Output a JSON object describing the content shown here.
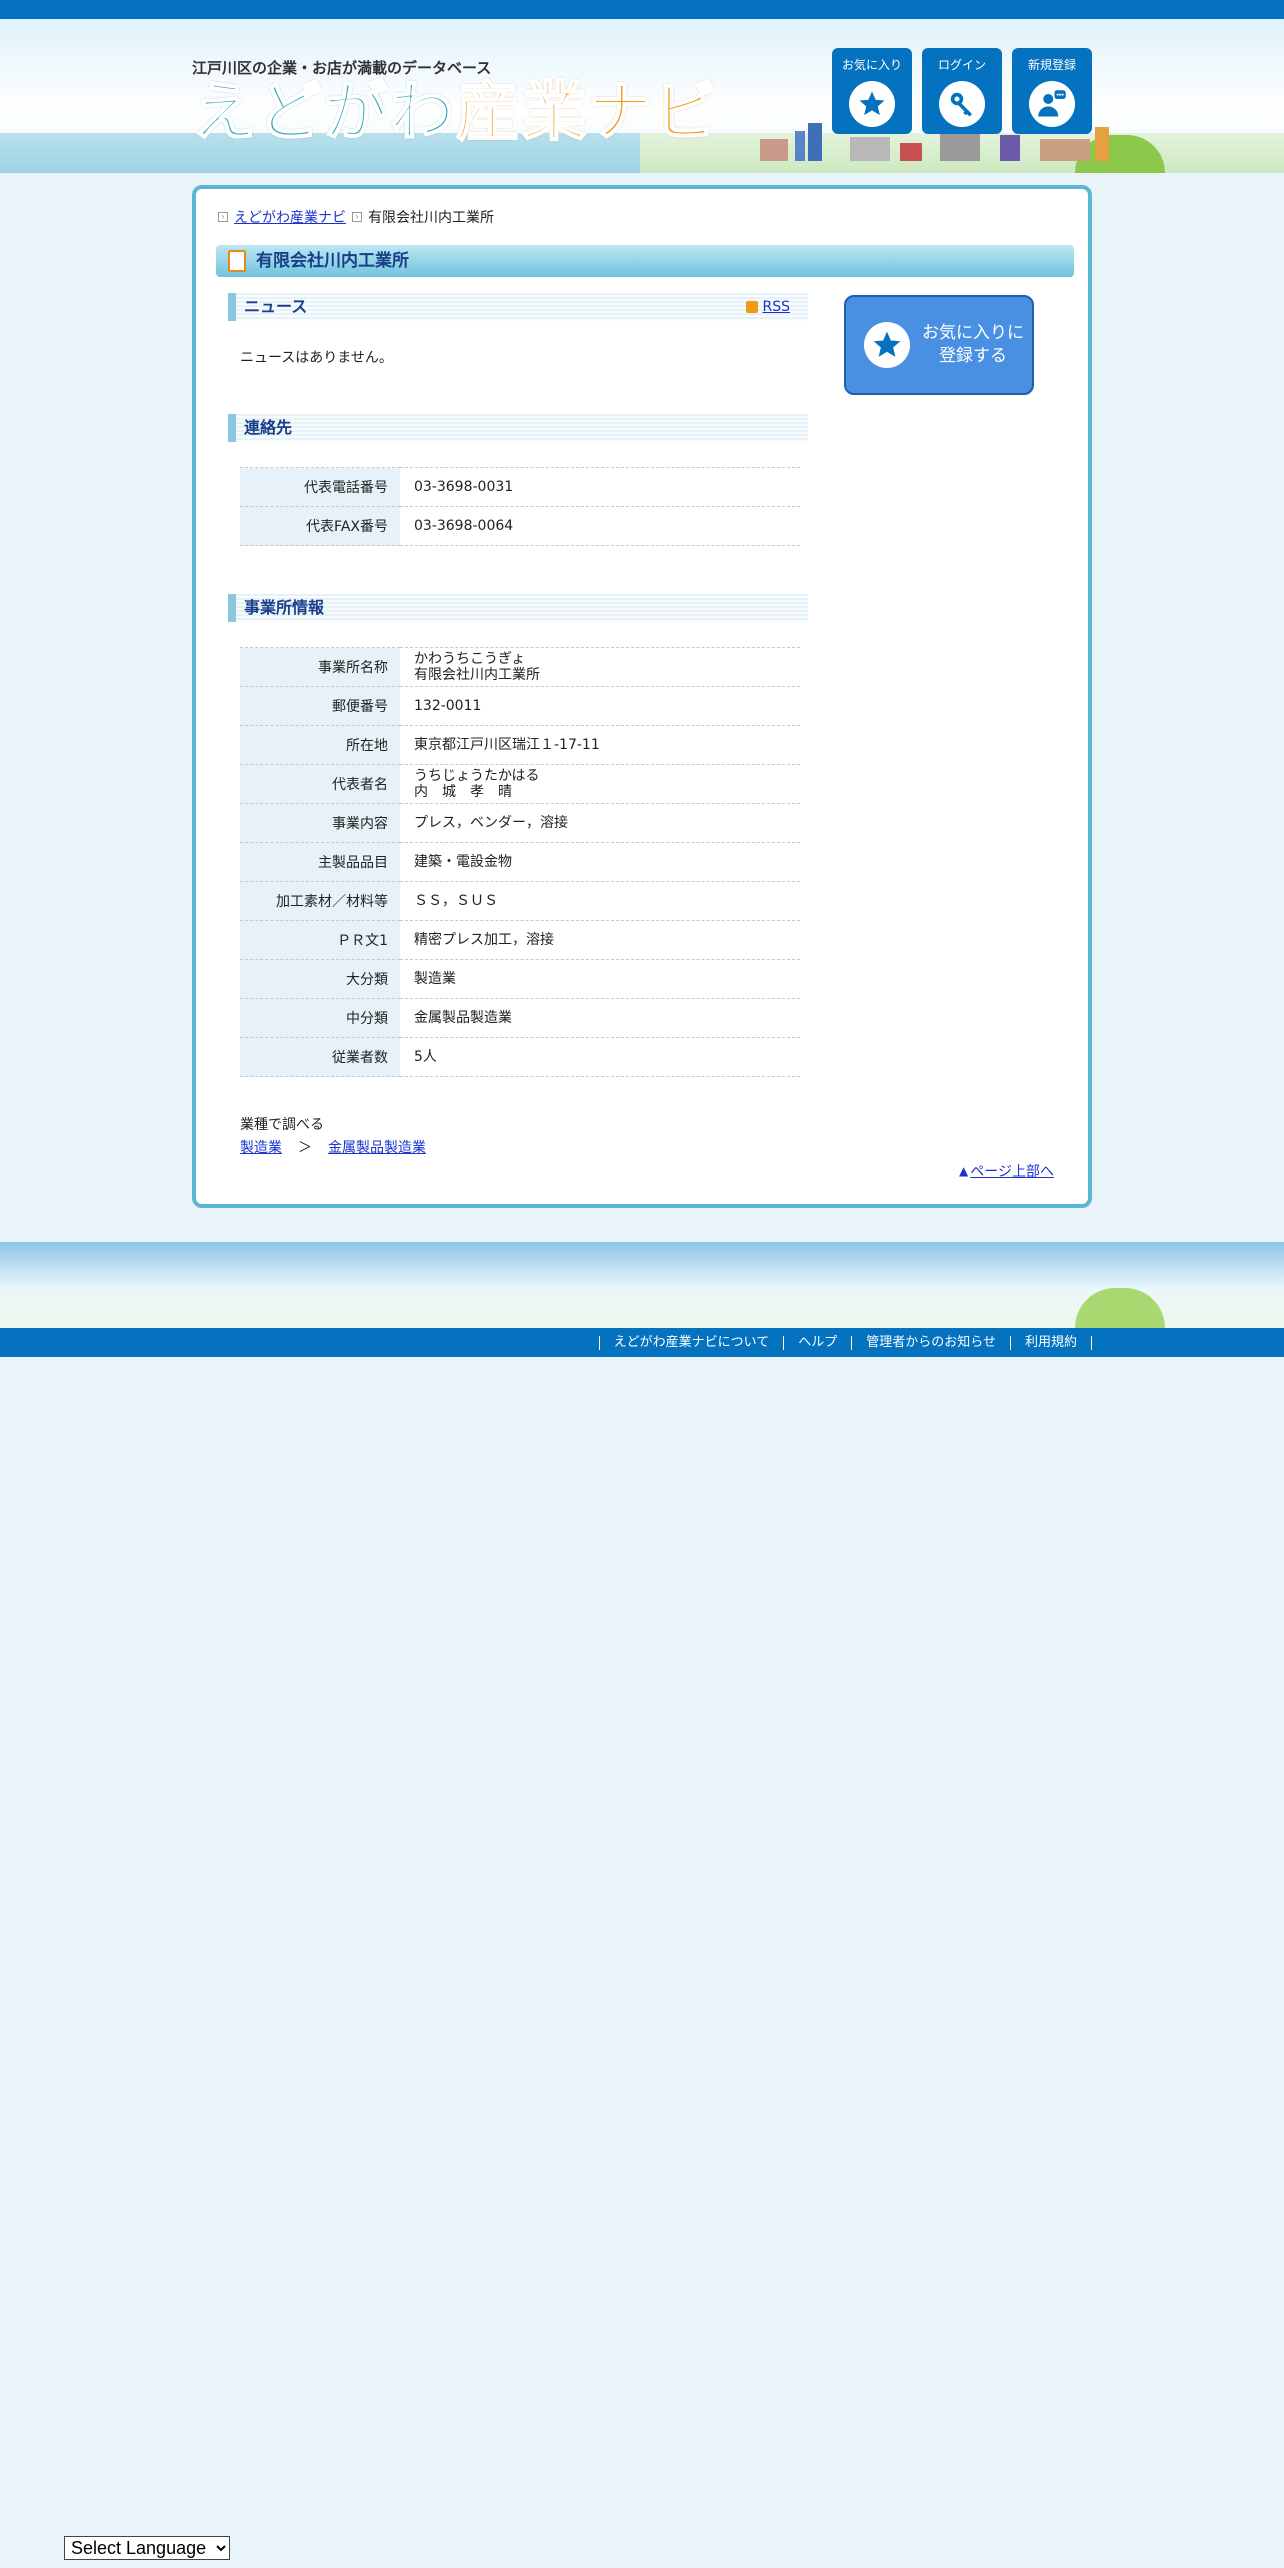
{
  "header": {
    "tagline": "江戸川区の企業・お店が満載のデータベース",
    "logo_part1": "えどがわ",
    "logo_part2": "産業ナビ",
    "buttons": {
      "favorites": "お気に入り",
      "login": "ログイン",
      "register": "新規登録"
    }
  },
  "breadcrumb": {
    "home": "えどがわ産業ナビ",
    "current": "有限会社川内工業所"
  },
  "page_title": "有限会社川内工業所",
  "news": {
    "heading": "ニュース",
    "rss": "RSS",
    "empty": "ニュースはありません。"
  },
  "contact": {
    "heading": "連絡先",
    "rows": [
      {
        "label": "代表電話番号",
        "value": "03-3698-0031"
      },
      {
        "label": "代表FAX番号",
        "value": "03-3698-0064"
      }
    ]
  },
  "office": {
    "heading": "事業所情報",
    "name_label": "事業所名称",
    "name_ruby": "かわうちこうぎょ",
    "name": "有限会社川内工業所",
    "postal_label": "郵便番号",
    "postal": "132-0011",
    "address_label": "所在地",
    "address": "東京都江戸川区瑞江１-17-11",
    "rep_label": "代表者名",
    "rep_ruby": "うちじょうたかはる",
    "rep": "内　城　孝　晴",
    "business_label": "事業内容",
    "business": "プレス，ベンダー，溶接",
    "products_label": "主製品品目",
    "products": "建築・電設金物",
    "materials_label": "加工素材／材料等",
    "materials": "ＳＳ，ＳＵＳ",
    "pr_label": "ＰＲ文1",
    "pr": "精密プレス加工，溶接",
    "major_label": "大分類",
    "major": "製造業",
    "middle_label": "中分類",
    "middle": "金属製品製造業",
    "staff_label": "従業者数",
    "staff": "5人"
  },
  "favorite_button": {
    "line1": "お気に入りに",
    "line2": "登録する"
  },
  "industry": {
    "label": "業種で調べる",
    "link1": "製造業",
    "separator": "＞",
    "link2": "金属製品製造業"
  },
  "to_top": {
    "arrow": "▲",
    "label": "ページ上部へ"
  },
  "footer": {
    "links": [
      "えどがわ産業ナビについて",
      "ヘルプ",
      "管理者からのお知らせ",
      "利用規約"
    ]
  },
  "language_select": "Select Language",
  "colors": {
    "primary": "#0472bf",
    "frame": "#5cb7d2",
    "favorite": "#4a90e2",
    "logo_teal": "#2fa7b6",
    "logo_orange": "#f39a13"
  }
}
